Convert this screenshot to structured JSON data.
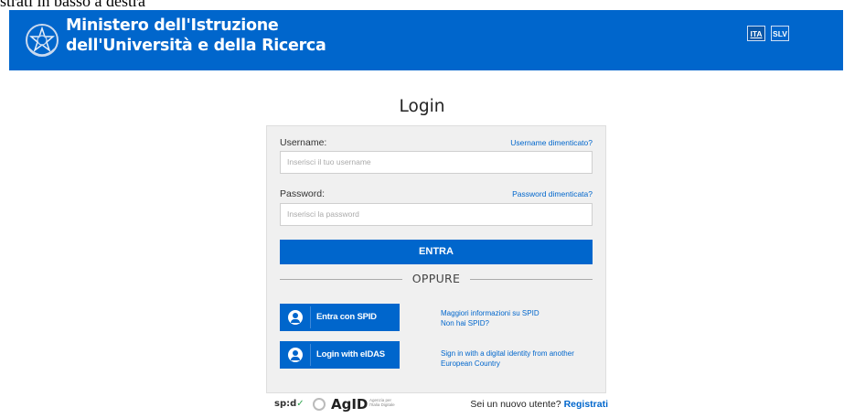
{
  "top_caption": "strati in basso a destra",
  "header": {
    "title_line1": "Ministero dell'Istruzione",
    "title_line2": "dell'Università e della Ricerca",
    "languages": [
      "ITA",
      "SLV"
    ],
    "brand_color": "#0066cc"
  },
  "login": {
    "title": "Login",
    "username_label": "Username:",
    "username_forgot": "Username dimenticato?",
    "username_placeholder": "Inserisci il tuo username",
    "password_label": "Password:",
    "password_forgot": "Password dimenticata?",
    "password_placeholder": "Inserisci la password",
    "submit_label": "ENTRA",
    "separator": "OPPURE"
  },
  "identity": {
    "spid_button": "Entra con SPID",
    "spid_info_line1": "Maggiori informazioni su SPID",
    "spid_info_line2": "Non hai SPID?",
    "eidas_button": "Login with eIDAS",
    "eidas_info_line1": "Sign in with a digital identity from another",
    "eidas_info_line2": "European Country"
  },
  "footer": {
    "spid_logo": "sp:d",
    "agid_logo": "AgID",
    "agid_sub": "Agenzia per l'Italia Digitale",
    "register_prompt": "Sei un nuovo utente?",
    "register_link": "Registrati"
  }
}
